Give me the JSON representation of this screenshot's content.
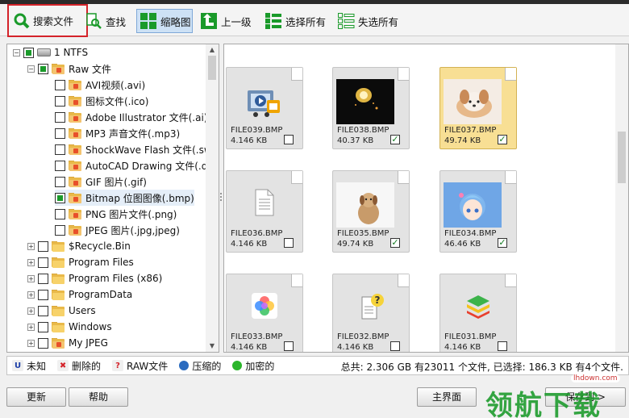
{
  "toolbar": {
    "search": "搜索文件",
    "find": "查找",
    "thumbnails": "缩略图",
    "up": "上一级",
    "select_all": "选择所有",
    "deselect_all": "失选所有"
  },
  "tree": {
    "items": [
      {
        "label": "1 NTFS",
        "icon": "drive-icon"
      },
      {
        "label": "Raw 文件",
        "icon": "folder-icon"
      },
      {
        "label": "AVI视频(.avi)",
        "icon": "folder-icon"
      },
      {
        "label": "图标文件(.ico)",
        "icon": "folder-icon"
      },
      {
        "label": "Adobe Illustrator 文件(.ai)",
        "icon": "folder-icon"
      },
      {
        "label": "MP3 声音文件(.mp3)",
        "icon": "folder-icon"
      },
      {
        "label": "ShockWave Flash 文件(.sw",
        "icon": "folder-icon"
      },
      {
        "label": "AutoCAD Drawing 文件(.d",
        "icon": "folder-icon"
      },
      {
        "label": "GIF 图片(.gif)",
        "icon": "folder-icon"
      },
      {
        "label": "Bitmap 位图图像(.bmp)",
        "icon": "folder-icon"
      },
      {
        "label": "PNG 图片文件(.png)",
        "icon": "folder-icon"
      },
      {
        "label": "JPEG 图片(.jpg,jpeg)",
        "icon": "folder-icon"
      },
      {
        "label": "$Recycle.Bin",
        "icon": "folder-icon"
      },
      {
        "label": "Program Files",
        "icon": "folder-icon"
      },
      {
        "label": "Program Files (x86)",
        "icon": "folder-icon"
      },
      {
        "label": "ProgramData",
        "icon": "folder-icon"
      },
      {
        "label": "Users",
        "icon": "folder-icon"
      },
      {
        "label": "Windows",
        "icon": "folder-icon"
      },
      {
        "label": "My JPEG",
        "icon": "folder-icon"
      }
    ]
  },
  "files": [
    {
      "name": "FILE039.BMP",
      "size": "4.146 KB",
      "checked": false,
      "thumb": "video-player-icon"
    },
    {
      "name": "FILE038.BMP",
      "size": "40.37 KB",
      "checked": true,
      "thumb": "fireworks-photo"
    },
    {
      "name": "FILE037.BMP",
      "size": "49.74 KB",
      "checked": true,
      "thumb": "puppy-photo"
    },
    {
      "name": "FILE036.BMP",
      "size": "4.146 KB",
      "checked": false,
      "thumb": "document-icon"
    },
    {
      "name": "FILE035.BMP",
      "size": "49.74 KB",
      "checked": true,
      "thumb": "dog-photo"
    },
    {
      "name": "FILE034.BMP",
      "size": "46.46 KB",
      "checked": true,
      "thumb": "anime-girl-photo"
    },
    {
      "name": "FILE033.BMP",
      "size": "4.146 KB",
      "checked": false,
      "thumb": "colorful-flower-icon"
    },
    {
      "name": "FILE032.BMP",
      "size": "4.146 KB",
      "checked": false,
      "thumb": "unknown-file-icon"
    },
    {
      "name": "FILE031.BMP",
      "size": "4.146 KB",
      "checked": false,
      "thumb": "bluestacks-icon"
    }
  ],
  "legend": {
    "unknown": "未知",
    "deleted": "删除的",
    "raw": "RAW文件",
    "compressed": "压缩的",
    "encrypted": "加密的",
    "summary": "总共: 2.306 GB 有23011 个文件, 已选择: 186.3 KB 有4个文件."
  },
  "buttons": {
    "refresh": "更新",
    "help": "帮助",
    "home": "主界面",
    "save": "保存到 >"
  },
  "watermark": {
    "text": "领航下载",
    "site": "lhdown.com"
  },
  "colors": {
    "accent": "#1a9a2a",
    "highlight_border": "#d4232a",
    "selected_card": "#f8df94"
  }
}
